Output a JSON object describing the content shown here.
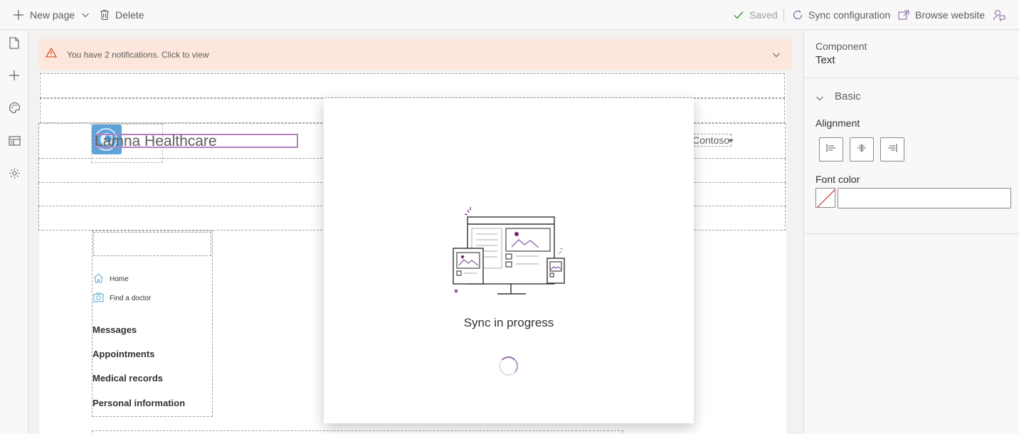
{
  "toolbar": {
    "new_page_label": "New page",
    "delete_label": "Delete",
    "saved_label": "Saved",
    "sync_label": "Sync configuration",
    "browse_label": "Browse website"
  },
  "left_rail": {
    "items": [
      "page-icon",
      "add-icon",
      "palette-icon",
      "layout-icon",
      "settings-icon"
    ]
  },
  "notification": {
    "text": "You have 2 notifications. Click to view"
  },
  "site": {
    "title": "Lamna Healthcare",
    "user_menu": "Contoso",
    "nav": [
      {
        "label": "Home",
        "icon": "home-icon"
      },
      {
        "label": "Find a doctor",
        "icon": "doctor-icon"
      }
    ],
    "menu": [
      "Messages",
      "Appointments",
      "Medical records",
      "Personal information"
    ]
  },
  "properties": {
    "component_caption": "Component",
    "component_value": "Text",
    "section_label": "Basic",
    "alignment_label": "Alignment",
    "font_color_label": "Font color",
    "font_color_value": ""
  },
  "modal": {
    "title": "Sync in progress"
  },
  "colors": {
    "accent": "#8e6aa8",
    "notice_bg": "#fde7dd",
    "warning": "#d83b01",
    "success": "#107c10"
  }
}
